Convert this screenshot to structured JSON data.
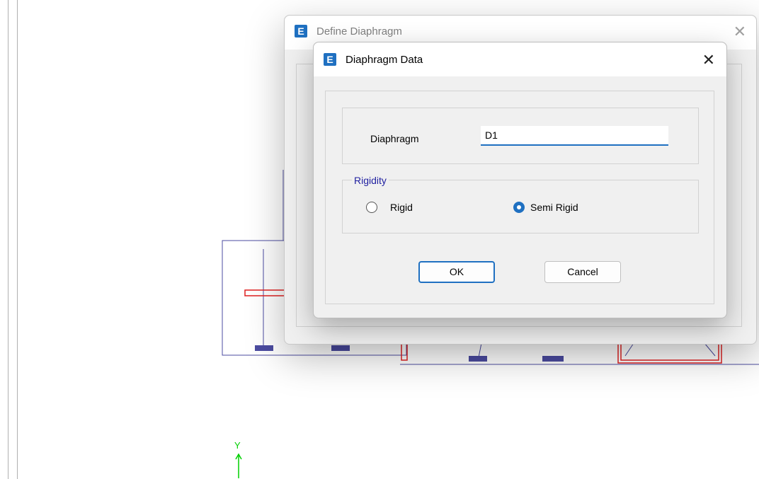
{
  "outer_dialog": {
    "title": "Define Diaphragm",
    "close": "✕",
    "app_icon": "E"
  },
  "inner_dialog": {
    "title": "Diaphragm Data",
    "close": "✕",
    "app_icon": "E",
    "diaphragm_label": "Diaphragm",
    "diaphragm_value": "D1",
    "rigidity": {
      "legend": "Rigidity",
      "options": [
        {
          "label": "Rigid",
          "selected": false
        },
        {
          "label": "Semi Rigid",
          "selected": true
        }
      ]
    },
    "ok_label": "OK",
    "cancel_label": "Cancel"
  },
  "canvas": {
    "axis_label": "Y",
    "axis_arrow": "↑"
  },
  "colors": {
    "accent": "#1f70c1",
    "plan_line": "#4b4ba0",
    "plan_red": "#e02020",
    "axis": "#00d000"
  }
}
